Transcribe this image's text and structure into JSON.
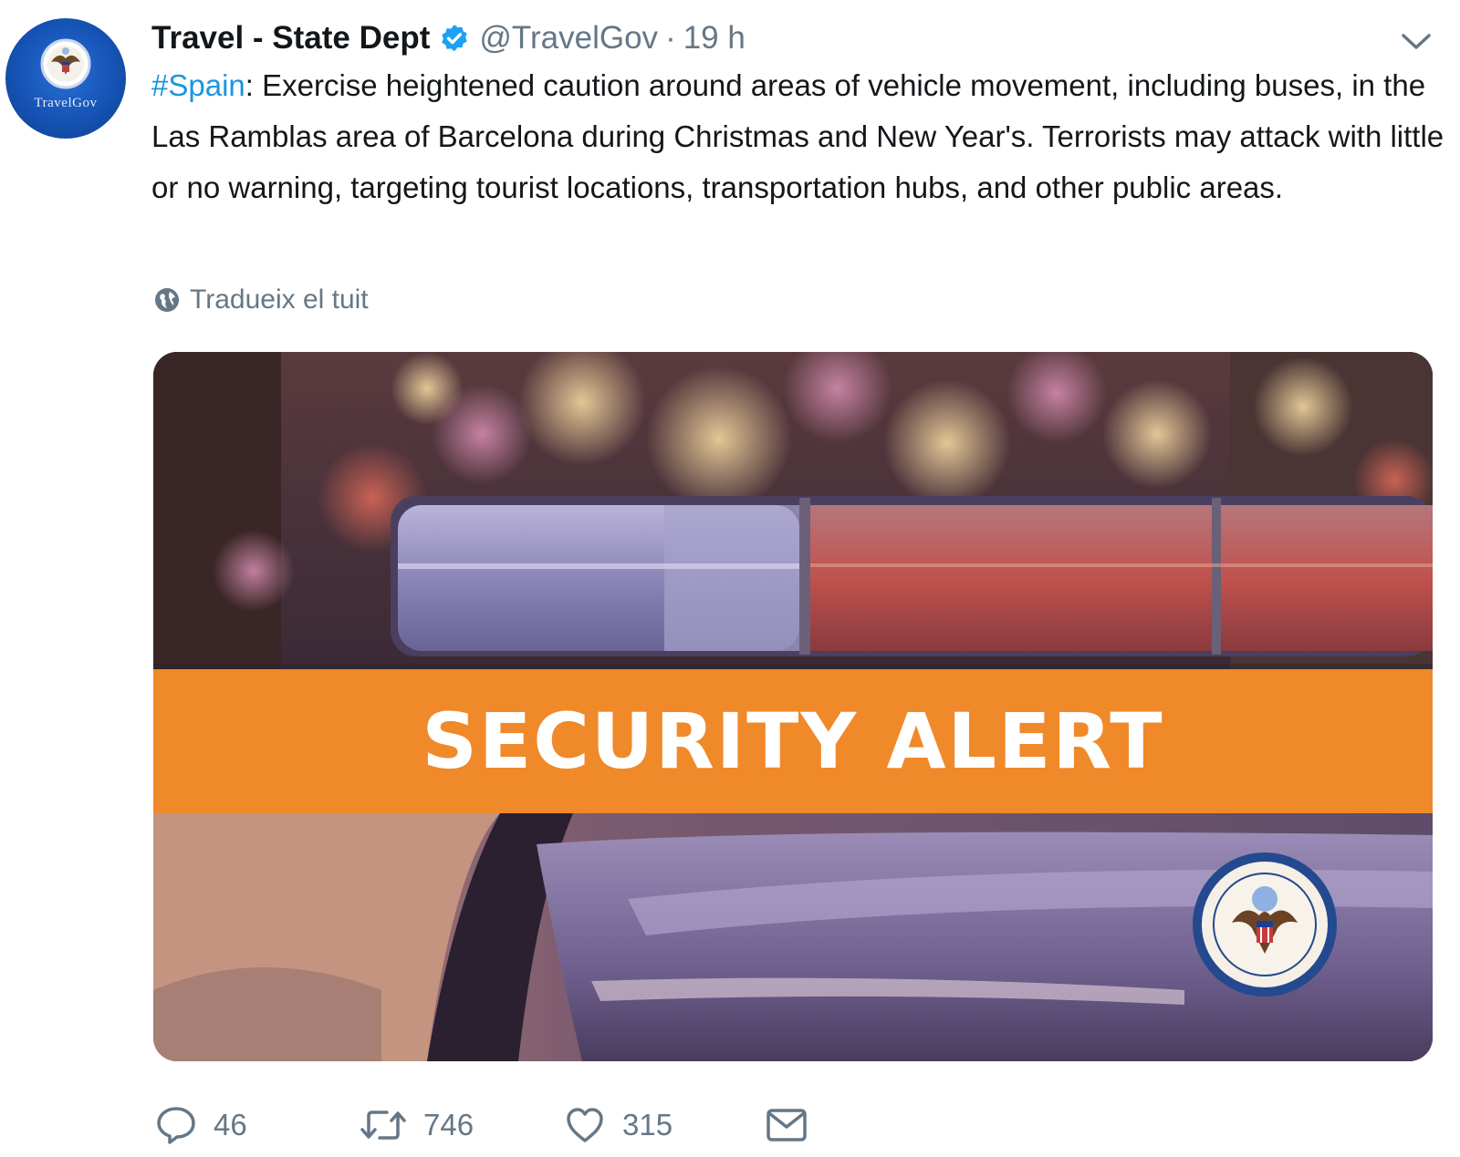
{
  "author": {
    "display_name": "Travel - State Dept",
    "handle": "@TravelGov",
    "separator": "·",
    "time": "19 h",
    "avatar_label": "TravelGov"
  },
  "tweet": {
    "hashtag": "#Spain",
    "text": ": Exercise heightened caution around areas of vehicle movement, including buses, in the Las Ramblas area of Barcelona during  Christmas and New Year's. Terrorists may attack with little or no warning, targeting tourist locations, transportation hubs, and other public areas."
  },
  "translate": {
    "label": "Tradueix el tuit"
  },
  "media": {
    "banner_text": "SECURITY ALERT",
    "banner_color": "#f0892a"
  },
  "actions": {
    "replies": "46",
    "retweets": "746",
    "likes": "315"
  },
  "colors": {
    "link": "#1b95e0",
    "secondary": "#657786",
    "verified": "#1da1f2"
  },
  "icons": [
    "verified-badge-icon",
    "chevron-down-icon",
    "globe-icon",
    "reply-icon",
    "retweet-icon",
    "like-icon",
    "direct-message-icon"
  ]
}
